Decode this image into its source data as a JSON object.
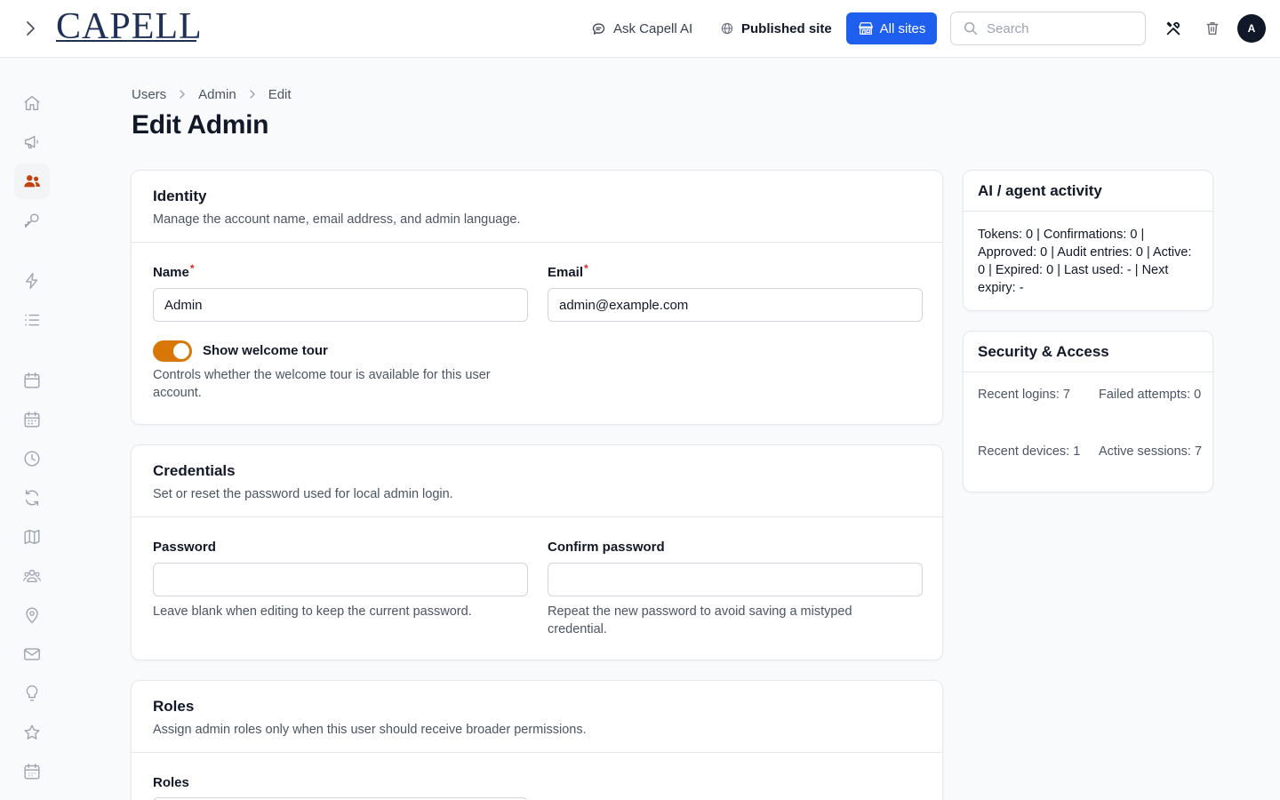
{
  "header": {
    "logo_text": "CAPELL",
    "ask_ai": "Ask Capell AI",
    "published_site": "Published site",
    "all_sites": "All sites",
    "search_placeholder": "Search",
    "avatar_initial": "A",
    "accent_color": "#1f5ff0"
  },
  "sidebar": {
    "active_color": "#c2410c",
    "items": [
      {
        "icon": "home-icon"
      },
      {
        "icon": "megaphone-icon"
      },
      {
        "icon": "users-icon",
        "active": true
      },
      {
        "icon": "key-icon"
      },
      {
        "icon": "bolt-icon"
      },
      {
        "icon": "list-icon"
      },
      {
        "icon": "calendar-icon"
      },
      {
        "icon": "calendar-grid-icon"
      },
      {
        "icon": "clock-icon"
      },
      {
        "icon": "refresh-icon"
      },
      {
        "icon": "map-icon"
      },
      {
        "icon": "user-group-icon"
      },
      {
        "icon": "map-pin-icon"
      },
      {
        "icon": "mail-icon"
      },
      {
        "icon": "lightbulb-icon"
      },
      {
        "icon": "star-icon"
      },
      {
        "icon": "calendar-days-icon"
      }
    ]
  },
  "breadcrumb": [
    "Users",
    "Admin",
    "Edit"
  ],
  "page_title": "Edit Admin",
  "identity": {
    "title": "Identity",
    "description": "Manage the account name, email address, and admin language.",
    "name_label": "Name",
    "name_value": "Admin",
    "email_label": "Email",
    "email_value": "admin@example.com",
    "required_mark": "*",
    "tour_label": "Show welcome tour",
    "tour_enabled": true,
    "tour_hint": "Controls whether the welcome tour is available for this user account.",
    "toggle_color": "#d97706"
  },
  "credentials": {
    "title": "Credentials",
    "description": "Set or reset the password used for local admin login.",
    "password_label": "Password",
    "password_value": "",
    "password_hint": "Leave blank when editing to keep the current password.",
    "confirm_label": "Confirm password",
    "confirm_value": "",
    "confirm_hint": "Repeat the new password to avoid saving a mistyped credential."
  },
  "roles": {
    "title": "Roles",
    "description": "Assign admin roles only when this user should receive broader permissions.",
    "roles_label": "Roles"
  },
  "ai_activity": {
    "title": "AI / agent activity",
    "summary": "Tokens: 0 | Confirmations: 0 | Approved: 0 | Audit entries: 0 | Active: 0 | Expired: 0 | Last used: - | Next expiry: -"
  },
  "security": {
    "title": "Security & Access",
    "recent_logins": "Recent logins: 7",
    "failed_attempts": "Failed attempts: 0",
    "recent_devices": "Recent devices: 1",
    "active_sessions": "Active sessions: 7"
  }
}
